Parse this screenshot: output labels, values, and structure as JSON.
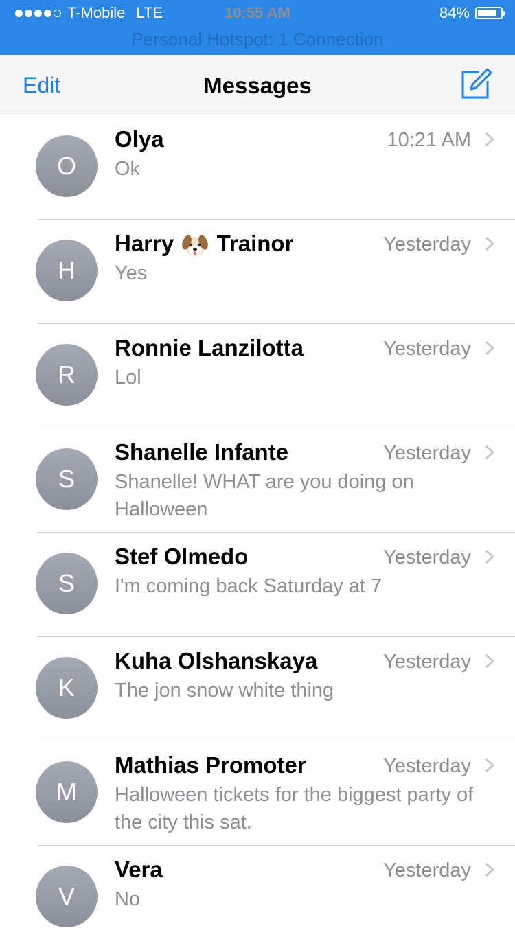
{
  "status_bar": {
    "carrier": "T-Mobile",
    "network": "LTE",
    "time": "10:55 AM",
    "battery": "84%",
    "battery_level": 0.84,
    "signal_bars_filled": 4,
    "signal_bars_total": 5,
    "hotspot_text": "Personal Hotspot: 1 Connection"
  },
  "nav": {
    "edit_label": "Edit",
    "title": "Messages",
    "compose_icon": "compose-icon"
  },
  "accent_color": "#1a82fb",
  "conversations": [
    {
      "initial": "O",
      "name": "Olya",
      "time": "10:21 AM",
      "preview": "Ok"
    },
    {
      "initial": "H",
      "name_first": "Harry",
      "name_emoji": "dog-face-emoji",
      "name_last": "Trainor",
      "time": "Yesterday",
      "preview": "Yes"
    },
    {
      "initial": "R",
      "name": "Ronnie Lanzilotta",
      "time": "Yesterday",
      "preview": "Lol"
    },
    {
      "initial": "S",
      "name": "Shanelle Infante",
      "time": "Yesterday",
      "preview": "Shanelle! WHAT are you doing on Halloween"
    },
    {
      "initial": "S",
      "name": "Stef Olmedo",
      "time": "Yesterday",
      "preview": "I'm coming back Saturday at 7"
    },
    {
      "initial": "K",
      "name": "Kuha Olshanskaya",
      "time": "Yesterday",
      "preview": "The jon snow white thing"
    },
    {
      "initial": "M",
      "name": "Mathias Promoter",
      "time": "Yesterday",
      "preview": "Halloween tickets for the biggest party of the city this sat."
    },
    {
      "initial": "V",
      "name": "Vera",
      "time": "Yesterday",
      "preview": "No"
    }
  ]
}
